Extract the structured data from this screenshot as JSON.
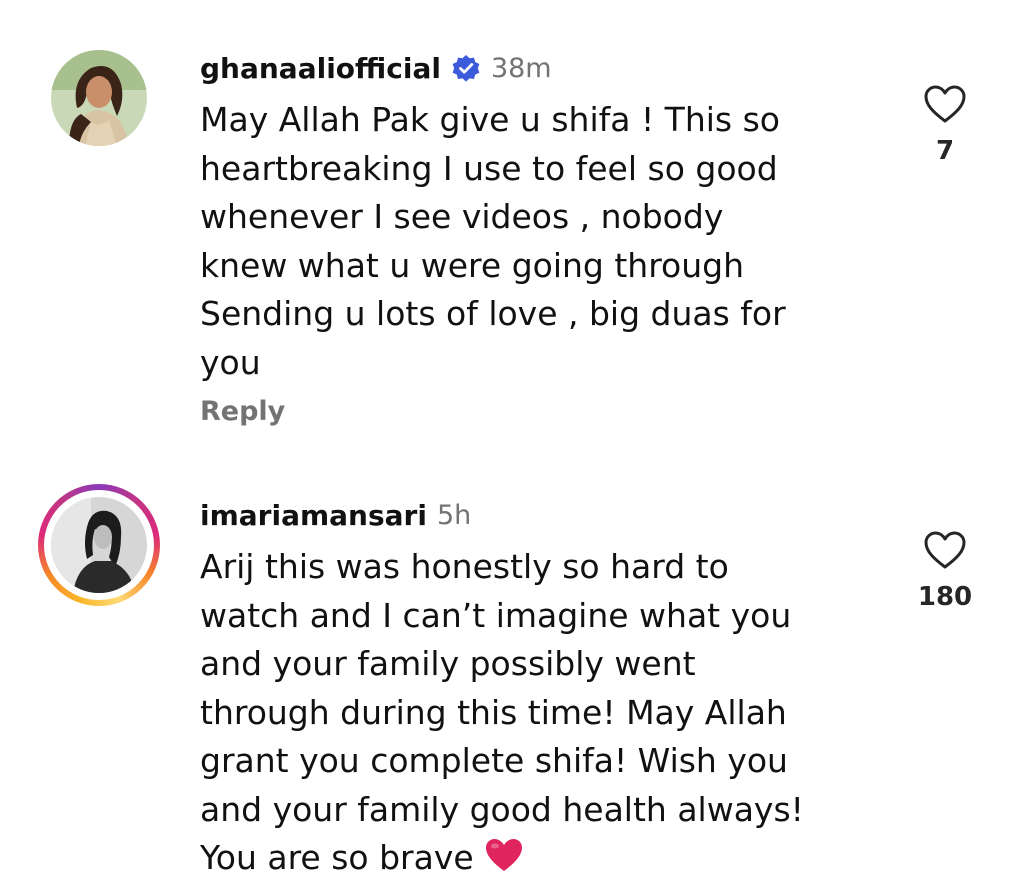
{
  "comments": [
    {
      "username": "ghanaaliofficial",
      "verified": true,
      "time": "38m",
      "text": "May Allah Pak give u shifa ! This so\nheartbreaking I use to feel so good\nwhenever I see videos , nobody\nknew what u were going through\nSending u lots of love , big duas for\nyou",
      "reply_label": "Reply",
      "likes": "7",
      "avatar_icon": "profile-photo",
      "like_icon": "heart-outline-icon"
    },
    {
      "username": "imariamansari",
      "verified": false,
      "time": "5h",
      "text": "Arij this was honestly so hard to\nwatch and I can’t imagine what you\nand your family  possibly went\nthrough during this time! May Allah\ngrant you complete shifa! Wish you\nand your family good health always!\nYou are so brave",
      "trailing_emoji": "❤️",
      "likes": "180",
      "avatar_icon": "profile-photo",
      "has_story_ring": true,
      "like_icon": "heart-outline-icon"
    }
  ],
  "colors": {
    "text": "#111111",
    "muted": "#737373",
    "verified_badge": "#3b5bdb",
    "heart_emoji": "#e0245e",
    "story_ring": [
      "#feda75",
      "#f58529",
      "#dd2a7b",
      "#8a3ab9"
    ]
  }
}
